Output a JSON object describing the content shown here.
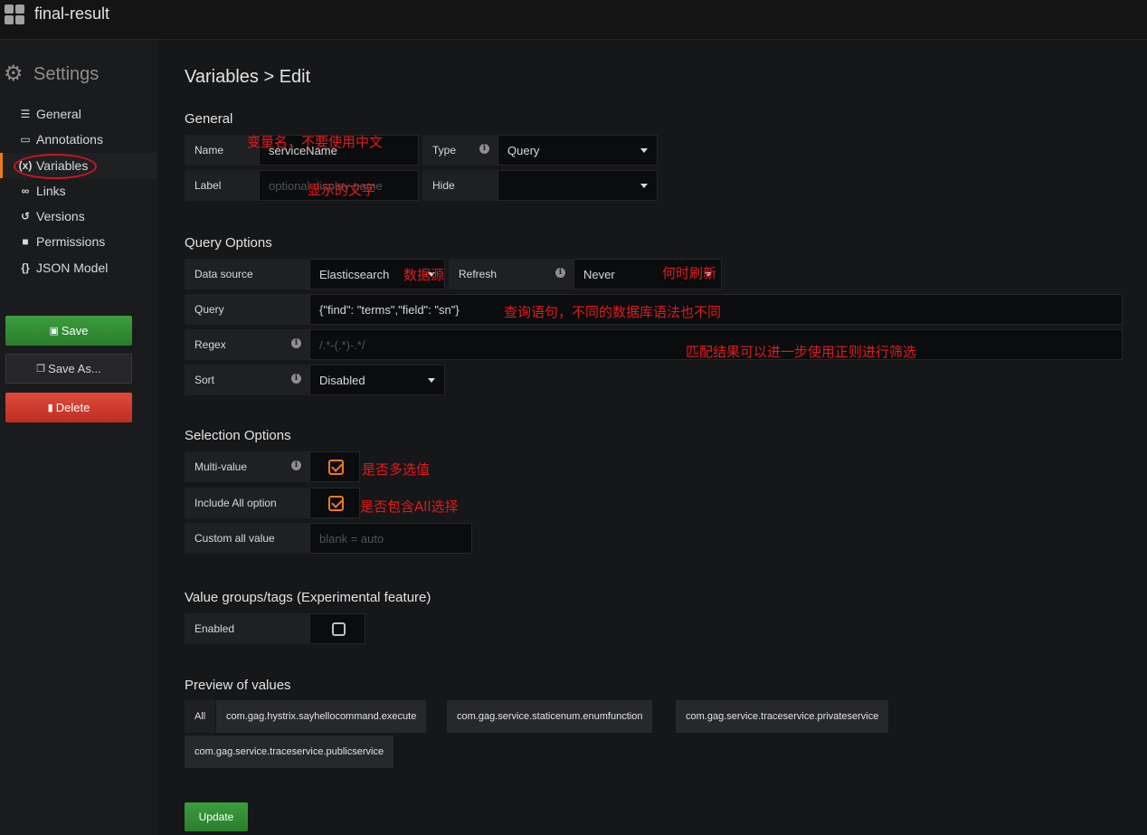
{
  "topbar": {
    "title": "final-result"
  },
  "sidebar": {
    "heading": "Settings",
    "items": [
      {
        "label": "General",
        "icon": "sliders-icon"
      },
      {
        "label": "Annotations",
        "icon": "comment-icon"
      },
      {
        "label": "Variables",
        "icon": "variable-icon"
      },
      {
        "label": "Links",
        "icon": "link-icon"
      },
      {
        "label": "Versions",
        "icon": "history-icon"
      },
      {
        "label": "Permissions",
        "icon": "lock-icon"
      },
      {
        "label": "JSON Model",
        "icon": "braces-icon"
      }
    ],
    "save_label": "Save",
    "save_as_label": "Save As...",
    "delete_label": "Delete"
  },
  "page": {
    "title": "Variables > Edit"
  },
  "general": {
    "title": "General",
    "name_label": "Name",
    "name_value": "serviceName",
    "type_label": "Type",
    "type_value": "Query",
    "label_label": "Label",
    "label_placeholder": "optional display name",
    "hide_label": "Hide",
    "hide_value": ""
  },
  "query_options": {
    "title": "Query Options",
    "datasource_label": "Data source",
    "datasource_value": "Elasticsearch",
    "refresh_label": "Refresh",
    "refresh_value": "Never",
    "query_label": "Query",
    "query_value": "{\"find\": \"terms\",\"field\": \"sn\"}",
    "regex_label": "Regex",
    "regex_placeholder": "/.*-(.*)-.*/",
    "sort_label": "Sort",
    "sort_value": "Disabled"
  },
  "selection_options": {
    "title": "Selection Options",
    "multi_label": "Multi-value",
    "multi_checked": true,
    "include_all_label": "Include All option",
    "include_all_checked": true,
    "custom_all_label": "Custom all value",
    "custom_all_placeholder": "blank = auto"
  },
  "value_groups": {
    "title": "Value groups/tags (Experimental feature)",
    "enabled_label": "Enabled",
    "enabled_checked": false
  },
  "preview": {
    "title": "Preview of values",
    "values": [
      "All",
      "com.gag.hystrix.sayhellocommand.execute",
      "com.gag.service.staticenum.enumfunction",
      "com.gag.service.traceservice.privateservice",
      "com.gag.service.traceservice.publicservice"
    ]
  },
  "update_label": "Update",
  "annotations": {
    "name_note": "变量名，不要使用中文",
    "label_note": "显示的文字",
    "datasource_note": "数据源",
    "refresh_note": "何时刷新",
    "query_note": "查询语句，不同的数据库语法也不同",
    "regex_note": "匹配结果可以进一步使用正则进行筛选",
    "multi_note": "是否多选值",
    "include_all_note": "是否包含All选择"
  },
  "colors": {
    "accent": "#eb7b18",
    "success": "#3b9e3d",
    "danger": "#e04a3a",
    "annotation": "#e11b1b"
  }
}
